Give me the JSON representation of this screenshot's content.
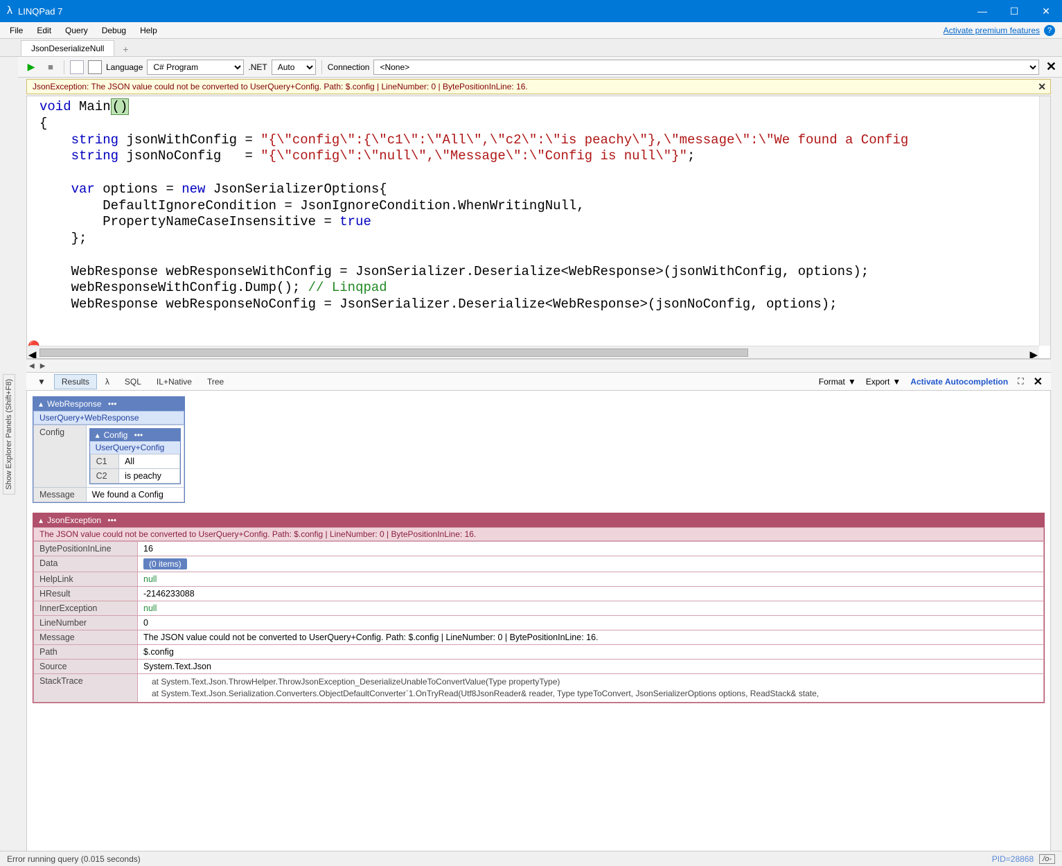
{
  "window": {
    "title": "LINQPad 7"
  },
  "menubar": {
    "items": [
      "File",
      "Edit",
      "Query",
      "Debug",
      "Help"
    ],
    "premium": "Activate premium features"
  },
  "tabs": {
    "active": "JsonDeserializeNull"
  },
  "toolbar": {
    "language_label": "Language",
    "language_value": "C# Program",
    "net_label": ".NET",
    "net_value": "Auto",
    "connection_label": "Connection",
    "connection_value": "<None>"
  },
  "sidebar_tab": "Show Explorer Panels  (Shift+F8)",
  "error_banner": "JsonException: The JSON value could not be converted to UserQuery+Config. Path: $.config | LineNumber: 0 | BytePositionInLine: 16.",
  "code": {
    "l1a": "void",
    "l1b": " Main",
    "l1c": "()",
    "l2": "{",
    "l3a": "string",
    "l3b": " jsonWithConfig = ",
    "l3c": "\"{\\\"config\\\":{\\\"c1\\\":\\\"All\\\",\\\"c2\\\":\\\"is peachy\\\"},\\\"message\\\":\\\"We found a Config",
    "l4a": "string",
    "l4b": " jsonNoConfig   = ",
    "l4c": "\"{\\\"config\\\":\\\"null\\\",\\\"Message\\\":\\\"Config is null\\\"}\"",
    "l4d": ";",
    "l5a": "var",
    "l5b": " options = ",
    "l5c": "new",
    "l5d": " JsonSerializerOptions{",
    "l6": "        DefaultIgnoreCondition = JsonIgnoreCondition.WhenWritingNull,",
    "l7a": "        PropertyNameCaseInsensitive = ",
    "l7b": "true",
    "l8": "    };",
    "l9": "    WebResponse webResponseWithConfig = JsonSerializer.Deserialize<WebResponse>(jsonWithConfig, options);",
    "l10a": "    webResponseWithConfig.Dump(); ",
    "l10b": "// Linqpad",
    "l11": "    WebResponse webResponseNoConfig = JsonSerializer.Deserialize<WebResponse>(jsonNoConfig, options);"
  },
  "result_tabs": {
    "down": "▼",
    "items": [
      "Results",
      "λ",
      "SQL",
      "IL+Native",
      "Tree"
    ],
    "format": "Format",
    "export": "Export",
    "autocomplete": "Activate Autocompletion"
  },
  "dump1": {
    "title": "WebResponse",
    "subtitle": "UserQuery+WebResponse",
    "config_label": "Config",
    "nested_title": "Config",
    "nested_subtitle": "UserQuery+Config",
    "rows": [
      [
        "C1",
        "All"
      ],
      [
        "C2",
        "is peachy"
      ]
    ],
    "message_label": "Message",
    "message_value": "We found a Config"
  },
  "exc": {
    "title": "JsonException",
    "subtitle": "The JSON value could not be converted to UserQuery+Config. Path: $.config | LineNumber: 0 | BytePositionInLine: 16.",
    "rows": [
      [
        "BytePositionInLine",
        "16",
        ""
      ],
      [
        "Data",
        "",
        "pill"
      ],
      [
        "HelpLink",
        "null",
        "null"
      ],
      [
        "HResult",
        "-2146233088",
        ""
      ],
      [
        "InnerException",
        "null",
        "null"
      ],
      [
        "LineNumber",
        "0",
        ""
      ],
      [
        "Message",
        "The JSON value could not be converted to UserQuery+Config. Path: $.config | LineNumber: 0 | BytePositionInLine: 16.",
        ""
      ],
      [
        "Path",
        "$.config",
        ""
      ],
      [
        "Source",
        "System.Text.Json",
        ""
      ]
    ],
    "data_pill": "(0 items)",
    "stack_label": "StackTrace",
    "stack": [
      "   at System.Text.Json.ThrowHelper.ThrowJsonException_DeserializeUnableToConvertValue(Type propertyType)",
      "   at System.Text.Json.Serialization.Converters.ObjectDefaultConverter`1.OnTryRead(Utf8JsonReader& reader, Type typeToConvert, JsonSerializerOptions options, ReadStack& state,"
    ]
  },
  "status": {
    "left": "Error running query  (0.015 seconds)",
    "pid": "PID=28868",
    "ins": "/o-"
  }
}
